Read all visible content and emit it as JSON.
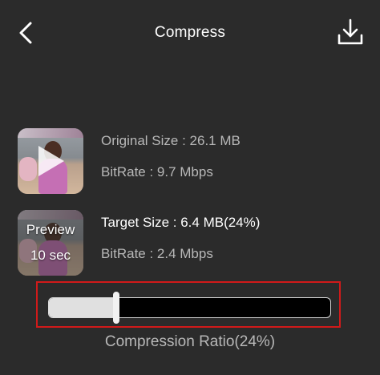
{
  "header": {
    "title": "Compress",
    "back_icon": "chevron-left-icon",
    "download_icon": "download-icon"
  },
  "original": {
    "size_text": "Original Size : 26.1 MB",
    "bitrate_text": "BitRate : 9.7 Mbps",
    "thumb_icon": "play-icon"
  },
  "target": {
    "size_text": "Target Size : 6.4 MB(24%)",
    "bitrate_text": "BitRate : 2.4 Mbps",
    "preview_label": "Preview",
    "preview_duration": "10 sec"
  },
  "compression": {
    "label": "Compression Ratio(24%)",
    "ratio": 0.24,
    "highlight_color": "#d11a1a"
  }
}
